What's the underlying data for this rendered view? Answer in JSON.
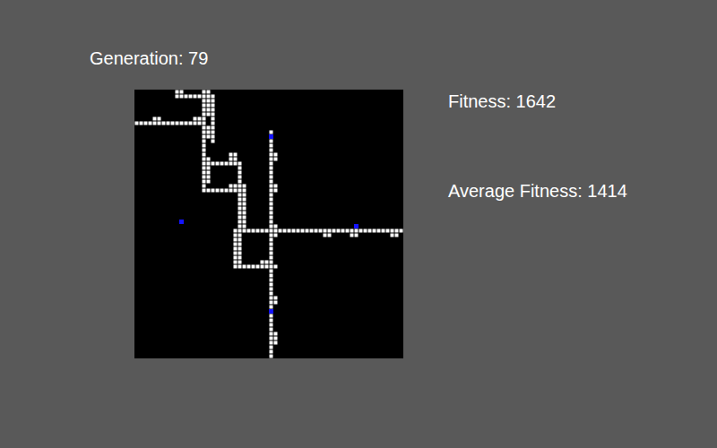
{
  "generation": {
    "label": "Generation: 79"
  },
  "stats": [
    {
      "label": "Fitness: 1642"
    },
    {
      "label": "Average Fitness: 1414"
    }
  ],
  "board": {
    "cols": 60,
    "rows": 60,
    "trail": [
      [
        30,
        9,
        30,
        59
      ],
      [
        22,
        31,
        59,
        31
      ],
      [
        31,
        14,
        31,
        15
      ],
      [
        31,
        21,
        31,
        22
      ],
      [
        31,
        30,
        31,
        30
      ],
      [
        31,
        32,
        31,
        32
      ],
      [
        42,
        32,
        43,
        32
      ],
      [
        48,
        32,
        49,
        32
      ],
      [
        57,
        32,
        58,
        32
      ],
      [
        31,
        46,
        31,
        47
      ],
      [
        31,
        54,
        31,
        56
      ],
      [
        9,
        0,
        10,
        0
      ],
      [
        15,
        0,
        16,
        0
      ],
      [
        9,
        1,
        17,
        1
      ],
      [
        15,
        2,
        15,
        6
      ],
      [
        16,
        2,
        16,
        5
      ],
      [
        17,
        1,
        17,
        11
      ],
      [
        0,
        7,
        15,
        7
      ],
      [
        4,
        6,
        5,
        6
      ],
      [
        13,
        6,
        14,
        6
      ],
      [
        15,
        7,
        15,
        22
      ],
      [
        16,
        8,
        16,
        10
      ],
      [
        16,
        15,
        16,
        20
      ],
      [
        17,
        16,
        23,
        16
      ],
      [
        21,
        15,
        22,
        15
      ],
      [
        21,
        14,
        22,
        14
      ],
      [
        23,
        16,
        23,
        33
      ],
      [
        15,
        22,
        23,
        22
      ],
      [
        21,
        21,
        22,
        21
      ],
      [
        24,
        21,
        24,
        30
      ],
      [
        22,
        31,
        22,
        39
      ],
      [
        23,
        32,
        23,
        38
      ],
      [
        22,
        39,
        31,
        39
      ],
      [
        28,
        38,
        29,
        38
      ]
    ],
    "food": [
      [
        10,
        29
      ],
      [
        30,
        10
      ],
      [
        49,
        30
      ],
      [
        30,
        49
      ]
    ]
  }
}
